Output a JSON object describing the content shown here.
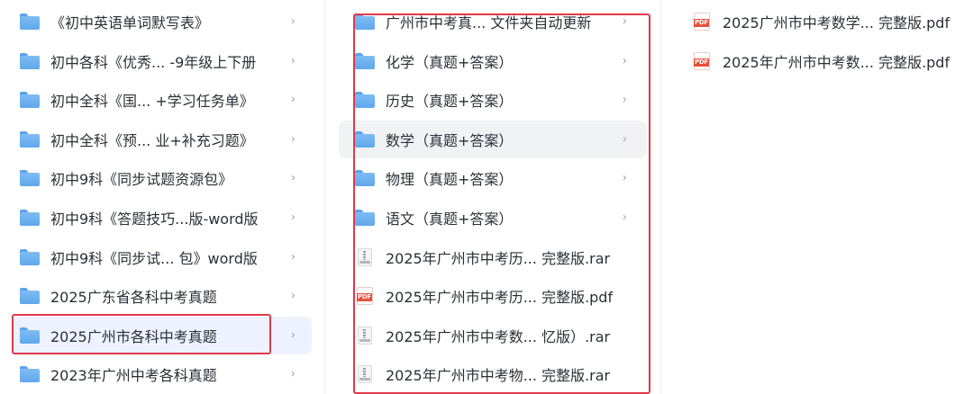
{
  "column1": {
    "items": [
      {
        "label": "《初中英语单词默写表》",
        "icon": "folder-icon",
        "chevron": "›"
      },
      {
        "label": "初中各科《优秀...  -9年级上下册",
        "icon": "folder-icon",
        "chevron": "›"
      },
      {
        "label": "初中全科《国...   +学习任务单》",
        "icon": "folder-icon",
        "chevron": "›"
      },
      {
        "label": "初中全科《预...   业+补充习题》",
        "icon": "folder-icon",
        "chevron": "›"
      },
      {
        "label": "初中9科《同步试题资源包》",
        "icon": "folder-icon",
        "chevron": "›"
      },
      {
        "label": "初中9科《答题技巧...版-word版",
        "icon": "folder-icon",
        "chevron": "›"
      },
      {
        "label": "初中9科《同步试...  包》word版",
        "icon": "folder-icon",
        "chevron": "›"
      },
      {
        "label": "2025广东省各科中考真题",
        "icon": "folder-icon",
        "chevron": "›"
      },
      {
        "label": "2025广州市各科中考真题",
        "icon": "folder-icon",
        "chevron": "›",
        "selected": true
      },
      {
        "label": "2023年广州中考各科真题",
        "icon": "folder-icon",
        "chevron": "›"
      }
    ]
  },
  "column2": {
    "items": [
      {
        "label": "广州市中考真...  文件夹自动更新",
        "icon": "folder-icon",
        "chevron": "›"
      },
      {
        "label": "化学（真题+答案）",
        "icon": "folder-icon",
        "chevron": "›"
      },
      {
        "label": "历史（真题+答案）",
        "icon": "folder-icon",
        "chevron": "›"
      },
      {
        "label": "数学（真题+答案）",
        "icon": "folder-icon",
        "chevron": "›",
        "hovered": true
      },
      {
        "label": "物理（真题+答案）",
        "icon": "folder-icon",
        "chevron": "›"
      },
      {
        "label": "语文（真题+答案）",
        "icon": "folder-icon",
        "chevron": "›"
      },
      {
        "label": "2025年广州市中考历...  完整版.rar",
        "icon": "rar-file-icon",
        "chevron": ""
      },
      {
        "label": "2025年广州市中考历...  完整版.pdf",
        "icon": "pdf-file-icon",
        "chevron": ""
      },
      {
        "label": "2025年广州市中考数...  忆版）.rar",
        "icon": "rar-file-icon",
        "chevron": ""
      },
      {
        "label": "2025年广州市中考物...  完整版.rar",
        "icon": "rar-file-icon",
        "chevron": ""
      }
    ]
  },
  "column3": {
    "items": [
      {
        "label": "2025广州市中考数学...  完整版.pdf",
        "icon": "pdf-file-icon"
      },
      {
        "label": "2025年广州市中考数...  完整版.pdf",
        "icon": "pdf-file-icon"
      }
    ]
  },
  "pdf_badge": "PDF",
  "colors": {
    "folder": "#6fb2f0",
    "selected_bg": "#eef2ff",
    "hover_bg": "#f1f2f4",
    "highlight_border": "#e0384b",
    "pdf_red": "#e5523b"
  }
}
